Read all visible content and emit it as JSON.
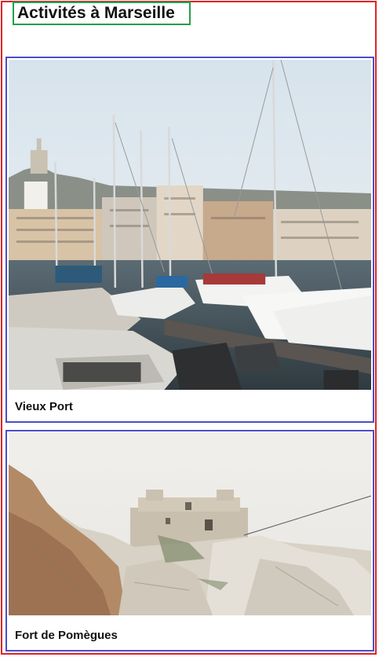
{
  "page": {
    "title": "Activités à Marseille"
  },
  "activities": [
    {
      "name": "Vieux Port",
      "image": "harbor-photo"
    },
    {
      "name": "Fort de Pomègues",
      "image": "fort-photo"
    }
  ],
  "colors": {
    "outer_border": "#e02424",
    "title_border": "#22a04a",
    "card_border": "#4a4fc8"
  }
}
